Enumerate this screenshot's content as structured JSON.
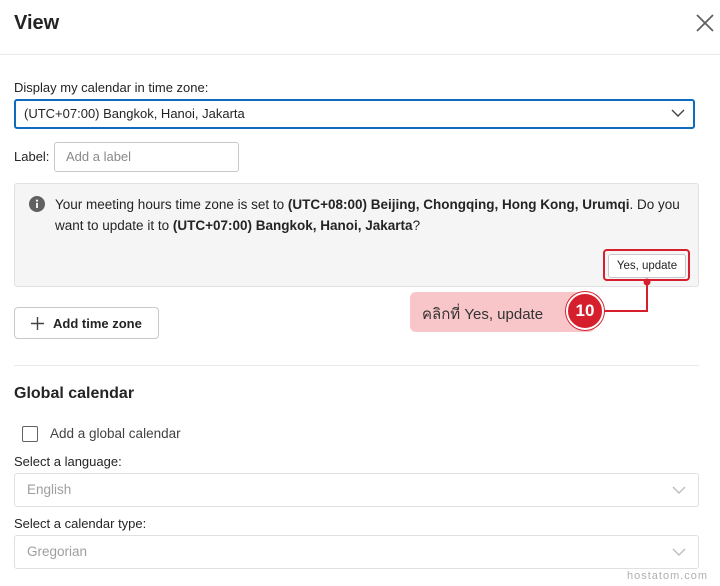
{
  "dialog": {
    "title": "View",
    "close_icon": "close-icon"
  },
  "timezone": {
    "label": "Display my calendar in time zone:",
    "selected": "(UTC+07:00) Bangkok, Hanoi, Jakarta",
    "label_field_label": "Label:",
    "label_placeholder": "Add a label"
  },
  "info": {
    "icon": "info-icon",
    "text_1": "Your meeting hours time zone is set to ",
    "current_tz": "(UTC+08:00) Beijing, Chongqing, Hong Kong, Urumqi",
    "text_2": ". Do you want to update it to ",
    "new_tz": "(UTC+07:00) Bangkok, Hanoi, Jakarta",
    "text_3": "?",
    "button_label": "Yes, update"
  },
  "annotation": {
    "callout_text": "คลิกที่ Yes, update",
    "step_number": "10",
    "color": "#d61f2c"
  },
  "add_time_zone": {
    "label": "Add time zone"
  },
  "global_calendar": {
    "title": "Global calendar",
    "checkbox_label": "Add a global calendar",
    "language_label": "Select a language:",
    "language_value": "English",
    "type_label": "Select a calendar type:",
    "type_value": "Gregorian"
  },
  "watermark": "hostatom.com",
  "colors": {
    "accent": "#0f6cbd",
    "highlight": "#d61f2c",
    "callout_bg": "#f8c6c9"
  }
}
